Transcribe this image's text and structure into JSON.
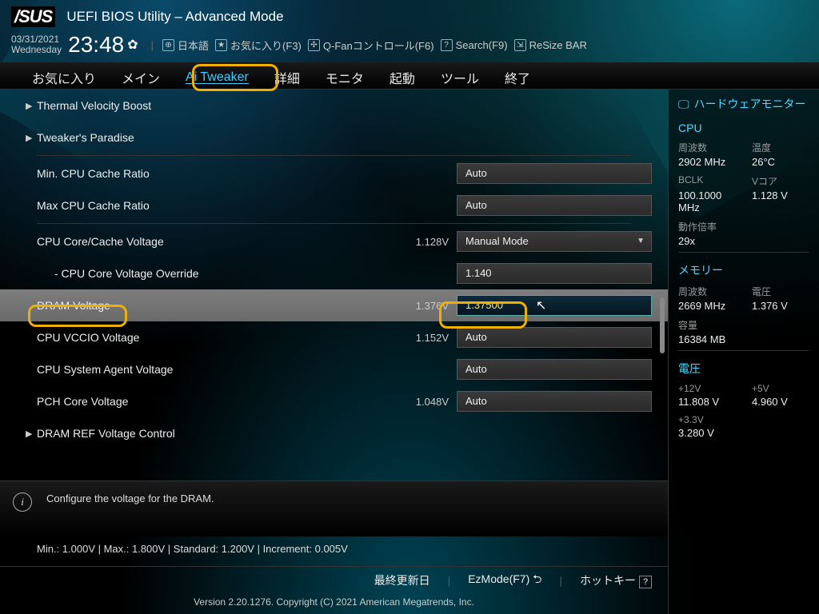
{
  "header": {
    "logo": "/SUS",
    "title": "UEFI BIOS Utility – Advanced Mode",
    "date": "03/31/2021",
    "weekday": "Wednesday",
    "time": "23:48",
    "toolbar": {
      "lang_label": "日本語",
      "fav_label": "お気に入り(F3)",
      "qfan_label": "Q-Fanコントロール(F6)",
      "search_label": "Search(F9)",
      "resize_label": "ReSize BAR"
    }
  },
  "tabs": [
    "お気に入り",
    "メイン",
    "Ai Tweaker",
    "詳細",
    "モニタ",
    "起動",
    "ツール",
    "終了"
  ],
  "active_tab_index": 2,
  "settings": [
    {
      "type": "submenu",
      "label": "Thermal Velocity Boost"
    },
    {
      "type": "submenu",
      "label": "Tweaker's Paradise"
    },
    {
      "type": "hr"
    },
    {
      "type": "text",
      "label": "Min. CPU Cache Ratio",
      "value": "Auto"
    },
    {
      "type": "text",
      "label": "Max CPU Cache Ratio",
      "value": "Auto"
    },
    {
      "type": "hr"
    },
    {
      "type": "dropdown",
      "label": "CPU Core/Cache Voltage",
      "current": "1.128V",
      "value": "Manual Mode"
    },
    {
      "type": "text",
      "label": "- CPU Core Voltage Override",
      "indent": true,
      "value": "1.140"
    },
    {
      "type": "text",
      "label": "DRAM Voltage",
      "current": "1.376V",
      "value": "1.37500",
      "selected": true,
      "highlight": true
    },
    {
      "type": "text",
      "label": "CPU VCCIO Voltage",
      "current": "1.152V",
      "value": "Auto"
    },
    {
      "type": "text",
      "label": "CPU System Agent Voltage",
      "value": "Auto"
    },
    {
      "type": "text",
      "label": "PCH Core Voltage",
      "current": "1.048V",
      "value": "Auto"
    },
    {
      "type": "submenu",
      "label": "DRAM REF Voltage Control"
    }
  ],
  "help": {
    "text": "Configure the voltage for the DRAM.",
    "range": "Min.: 1.000V   |   Max.: 1.800V   |   Standard: 1.200V   |   Increment: 0.005V"
  },
  "footer": {
    "last_update": "最終更新日",
    "ezmode": "EzMode(F7)",
    "hotkey": "ホットキー",
    "version": "Version 2.20.1276. Copyright (C) 2021 American Megatrends, Inc."
  },
  "monitor": {
    "title": "ハードウェアモニター",
    "cpu_label": "CPU",
    "cpu": {
      "freq_k": "周波数",
      "freq_v": "2902 MHz",
      "temp_k": "温度",
      "temp_v": "26°C",
      "bclk_k": "BCLK",
      "bclk_v": "100.1000 MHz",
      "vcore_k": "Vコア",
      "vcore_v": "1.128 V",
      "ratio_k": "動作倍率",
      "ratio_v": "29x"
    },
    "mem_label": "メモリー",
    "mem": {
      "freq_k": "周波数",
      "freq_v": "2669 MHz",
      "volt_k": "電圧",
      "volt_v": "1.376 V",
      "cap_k": "容量",
      "cap_v": "16384 MB"
    },
    "volt_label": "電圧",
    "volt": {
      "v12_k": "+12V",
      "v12_v": "11.808 V",
      "v5_k": "+5V",
      "v5_v": "4.960 V",
      "v33_k": "+3.3V",
      "v33_v": "3.280 V"
    }
  }
}
